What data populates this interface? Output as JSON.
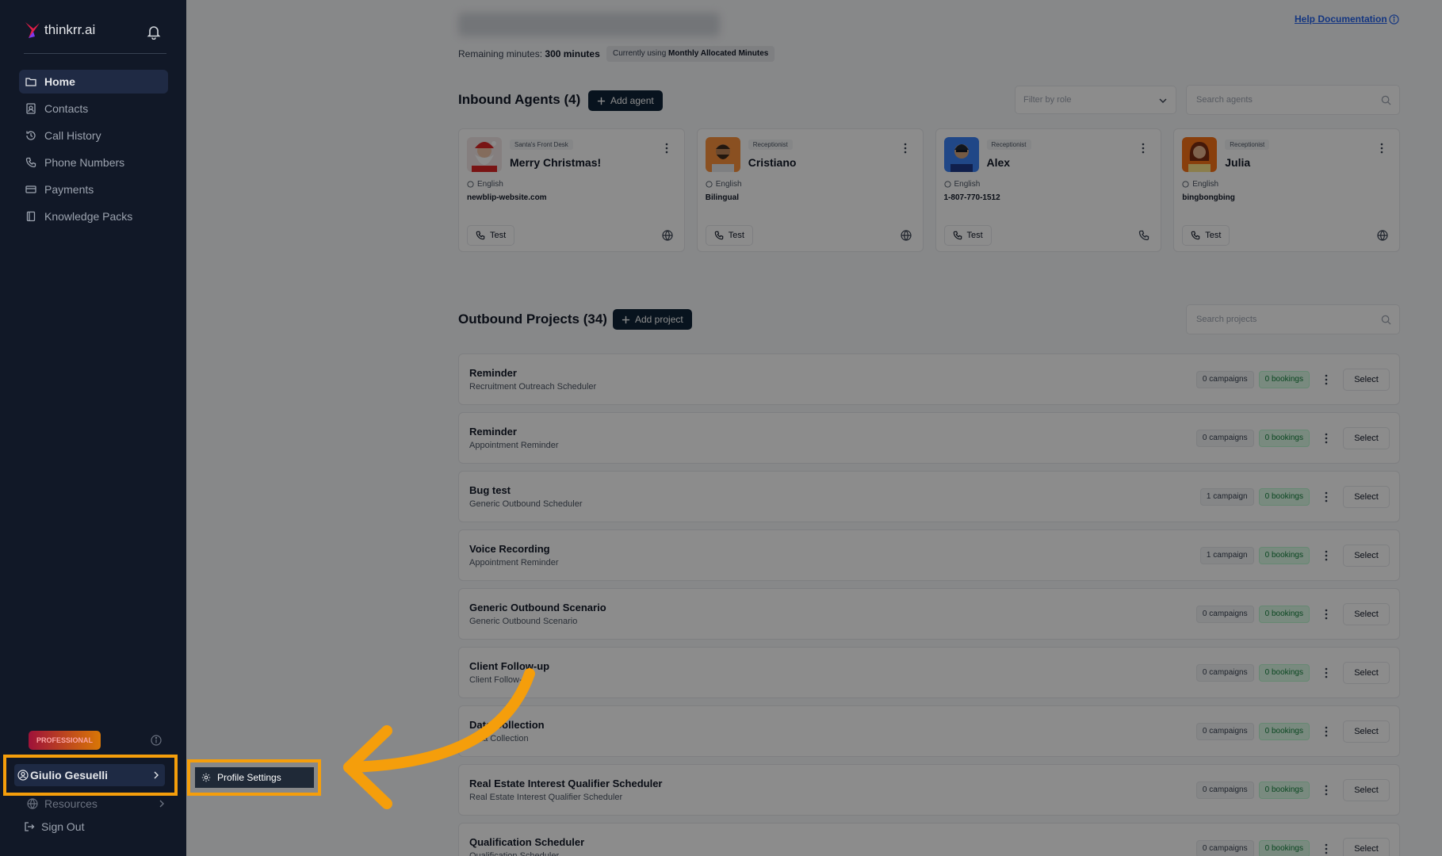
{
  "brand": {
    "name": "thinkrr.ai",
    "accent": "#f59e0b",
    "primary": "#0f2438"
  },
  "sidebar": {
    "items": [
      {
        "label": "Home",
        "icon": "folder-icon",
        "active": true
      },
      {
        "label": "Contacts",
        "icon": "contacts-icon",
        "active": false
      },
      {
        "label": "Call History",
        "icon": "history-icon",
        "active": false
      },
      {
        "label": "Phone Numbers",
        "icon": "phone-icon",
        "active": false
      },
      {
        "label": "Payments",
        "icon": "credit-card-icon",
        "active": false
      },
      {
        "label": "Knowledge Packs",
        "icon": "book-icon",
        "active": false
      }
    ],
    "plan_badge": "PROFESSIONAL",
    "user_name": "Giulio Gesuelli",
    "resources_label": "Resources",
    "sign_out_label": "Sign Out"
  },
  "popup": {
    "profile_settings_label": "Profile Settings"
  },
  "header": {
    "help_link": "Help Documentation",
    "remaining_label": "Remaining minutes:",
    "remaining_value": "300 minutes",
    "usage_prefix": "Currently using",
    "usage_value": "Monthly Allocated Minutes"
  },
  "inbound": {
    "title": "Inbound Agents (4)",
    "add_label": "Add agent",
    "filter_placeholder": "Filter by role",
    "search_placeholder": "Search agents",
    "agents": [
      {
        "role": "Santa's Front Desk",
        "name": "Merry Christmas!",
        "language": "English",
        "contact": "newblip-website.com",
        "test_label": "Test",
        "channel_icon": "globe-icon"
      },
      {
        "role": "Receptionist",
        "name": "Cristiano",
        "language": "English",
        "contact": "Bilingual",
        "test_label": "Test",
        "channel_icon": "globe-icon"
      },
      {
        "role": "Receptionist",
        "name": "Alex",
        "language": "English",
        "contact": "1-807-770-1512",
        "test_label": "Test",
        "channel_icon": "phone-icon"
      },
      {
        "role": "Receptionist",
        "name": "Julia",
        "language": "English",
        "contact": "bingbongbing",
        "test_label": "Test",
        "channel_icon": "globe-icon"
      }
    ]
  },
  "outbound": {
    "title": "Outbound Projects (34)",
    "add_label": "Add project",
    "search_placeholder": "Search projects",
    "select_label": "Select",
    "projects": [
      {
        "name": "Reminder",
        "subtitle": "Recruitment Outreach Scheduler",
        "campaigns": "0 campaigns",
        "bookings": "0 bookings"
      },
      {
        "name": "Reminder",
        "subtitle": "Appointment Reminder",
        "campaigns": "0 campaigns",
        "bookings": "0 bookings"
      },
      {
        "name": "Bug test",
        "subtitle": "Generic Outbound Scheduler",
        "campaigns": "1 campaign",
        "bookings": "0 bookings"
      },
      {
        "name": "Voice Recording",
        "subtitle": "Appointment Reminder",
        "campaigns": "1 campaign",
        "bookings": "0 bookings"
      },
      {
        "name": "Generic Outbound Scenario",
        "subtitle": "Generic Outbound Scenario",
        "campaigns": "0 campaigns",
        "bookings": "0 bookings"
      },
      {
        "name": "Client Follow-up",
        "subtitle": "Client Follow-up",
        "campaigns": "0 campaigns",
        "bookings": "0 bookings"
      },
      {
        "name": "Data Collection",
        "subtitle": "Data Collection",
        "campaigns": "0 campaigns",
        "bookings": "0 bookings"
      },
      {
        "name": "Real Estate Interest Qualifier Scheduler",
        "subtitle": "Real Estate Interest Qualifier Scheduler",
        "campaigns": "0 campaigns",
        "bookings": "0 bookings"
      },
      {
        "name": "Qualification Scheduler",
        "subtitle": "Qualification Scheduler",
        "campaigns": "0 campaigns",
        "bookings": "0 bookings"
      }
    ]
  }
}
